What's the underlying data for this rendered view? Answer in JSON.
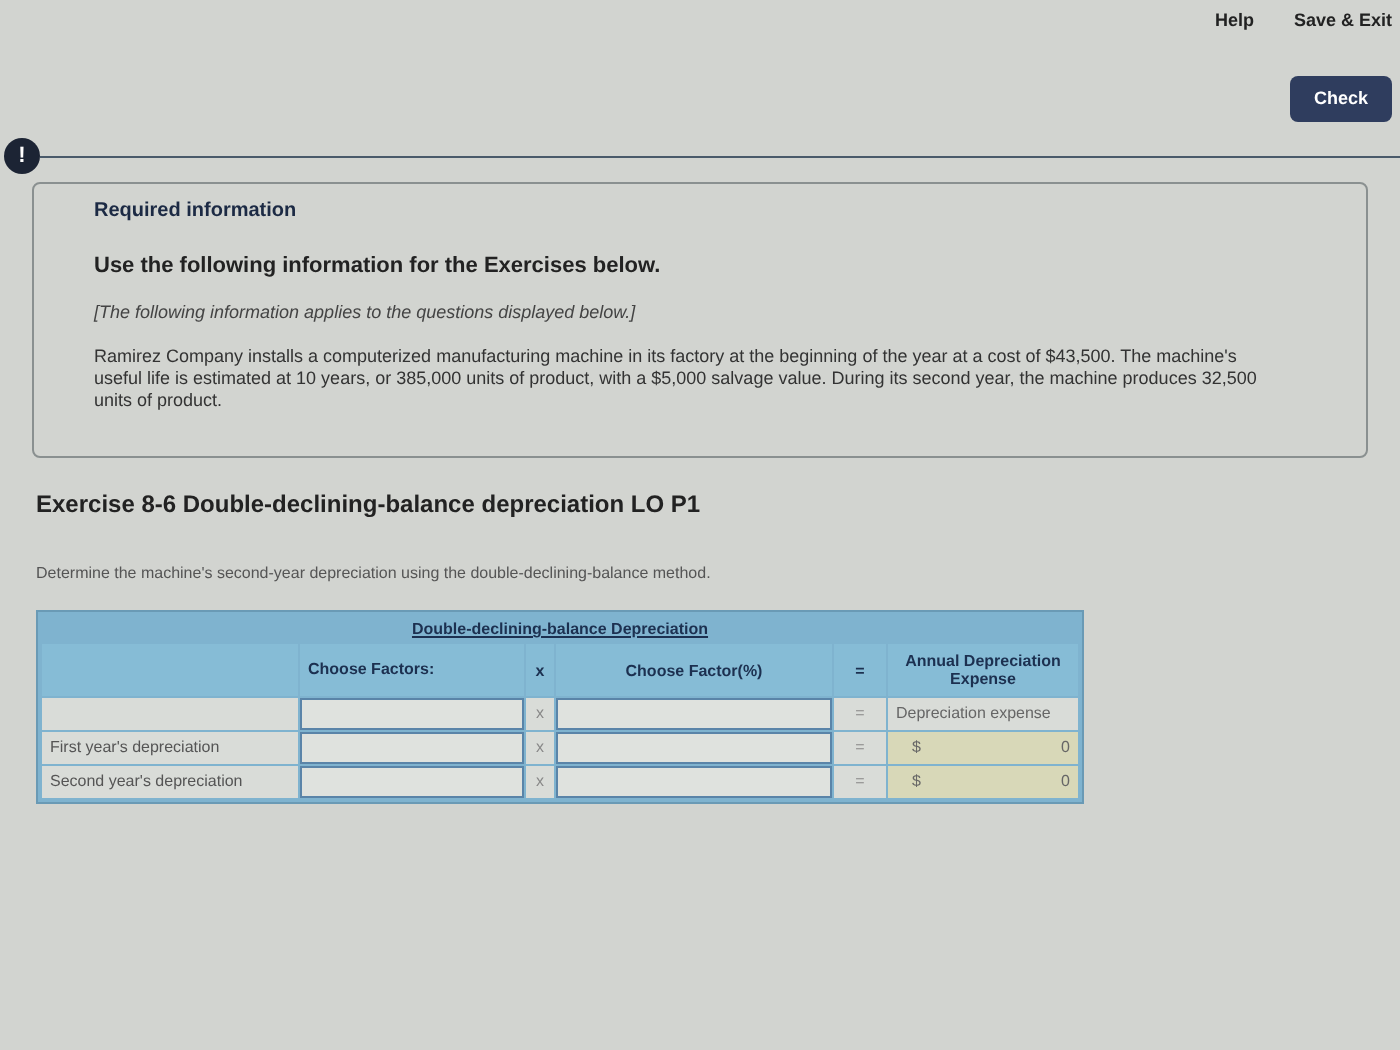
{
  "top_links": [
    "Help",
    "Save & Exit"
  ],
  "check_button": "Check",
  "alert_mark": "!",
  "info": {
    "heading": "Required information",
    "subheading": "Use the following information for the Exercises below.",
    "note": "[The following information applies to the questions displayed below.]",
    "body": "Ramirez Company installs a computerized manufacturing machine in its factory at the beginning of the year at a cost of $43,500. The machine's useful life is estimated at 10 years, or 385,000 units of product, with a $5,000 salvage value. During its second year, the machine produces 32,500 units of product."
  },
  "exercise": {
    "title": "Exercise 8-6 Double-declining-balance depreciation LO P1",
    "instruction": "Determine the machine's second-year depreciation using the double-declining-balance method."
  },
  "table": {
    "title": "Double-declining-balance Depreciation",
    "columns": [
      "Choose Factors:",
      "x",
      "Choose Factor(%)",
      "=",
      "Annual Depreciation Expense"
    ],
    "rows": [
      {
        "kind": "caption",
        "times": "x",
        "equals": "=",
        "caption": "Depreciation expense"
      },
      {
        "kind": "value",
        "label": "First year's depreciation",
        "times": "x",
        "equals": "=",
        "currency": "$",
        "result": "0"
      },
      {
        "kind": "value",
        "label": "Second year's depreciation",
        "times": "x",
        "equals": "=",
        "currency": "$",
        "result": "0"
      }
    ]
  }
}
